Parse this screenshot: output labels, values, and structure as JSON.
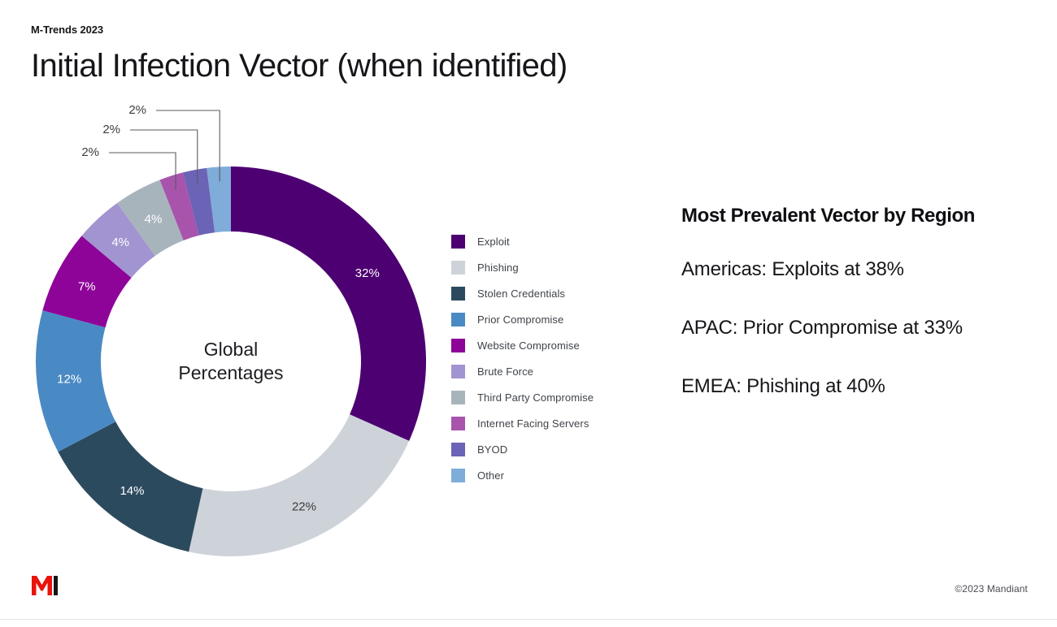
{
  "header": {
    "eyebrow": "M-Trends 2023",
    "title": "Initial Infection Vector (when identified)"
  },
  "chart_data": {
    "type": "pie",
    "variant": "donut",
    "title": "Initial Infection Vector (when identified)",
    "center_label_line1": "Global",
    "center_label_line2": "Percentages",
    "units": "%",
    "start_angle_deg": 0,
    "direction": "clockwise",
    "categories": [
      "Exploit",
      "Phishing",
      "Stolen Credentials",
      "Prior Compromise",
      "Website Compromise",
      "Brute Force",
      "Third Party Compromise",
      "Internet Facing Servers",
      "BYOD",
      "Other"
    ],
    "values": [
      32,
      22,
      14,
      12,
      7,
      4,
      4,
      2,
      2,
      2
    ],
    "value_labels": [
      "32%",
      "22%",
      "14%",
      "12%",
      "7%",
      "4%",
      "4%",
      "2%",
      "2%",
      "2%"
    ],
    "colors": [
      "#4d0072",
      "#ced3d9",
      "#2c4a5e",
      "#4a8ac4",
      "#8e0499",
      "#a294d0",
      "#a8b4bc",
      "#a854ac",
      "#6b63b5",
      "#7facd8"
    ],
    "label_text_colors": [
      "#ffffff",
      "#3c3c42",
      "#ffffff",
      "#ffffff",
      "#ffffff",
      "#ffffff",
      "#ffffff",
      "#3c3c42",
      "#3c3c42",
      "#3c3c42"
    ],
    "callout_indices": [
      7,
      8,
      9
    ],
    "legend_position": "right",
    "grid": false
  },
  "legend": {
    "items": [
      {
        "label": "Exploit",
        "color": "#4d0072"
      },
      {
        "label": "Phishing",
        "color": "#ced3d9"
      },
      {
        "label": "Stolen Credentials",
        "color": "#2c4a5e"
      },
      {
        "label": "Prior Compromise",
        "color": "#4a8ac4"
      },
      {
        "label": "Website Compromise",
        "color": "#8e0499"
      },
      {
        "label": "Brute Force",
        "color": "#a294d0"
      },
      {
        "label": "Third Party Compromise",
        "color": "#a8b4bc"
      },
      {
        "label": "Internet Facing Servers",
        "color": "#a854ac"
      },
      {
        "label": "BYOD",
        "color": "#6b63b5"
      },
      {
        "label": "Other",
        "color": "#7facd8"
      }
    ]
  },
  "region_panel": {
    "heading": "Most Prevalent Vector by Region",
    "lines": [
      "Americas: Exploits at 38%",
      "APAC: Prior Compromise at 33%",
      "EMEA: Phishing at 40%"
    ]
  },
  "footer": {
    "copyright": "©2023 Mandiant",
    "logo_mark_color": "#e8140c",
    "logo_letter": "M"
  }
}
